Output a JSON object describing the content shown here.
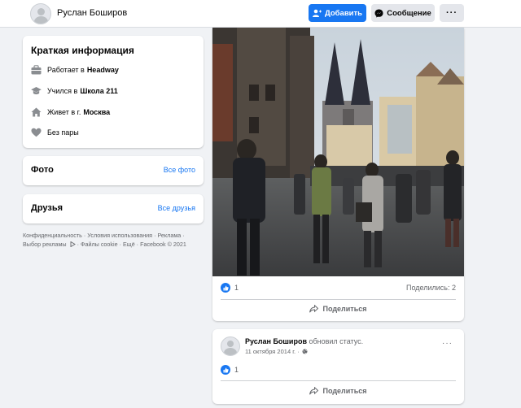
{
  "header": {
    "page_name": "Руслан Боширов",
    "add_label": "Добавить",
    "message_label": "Сообщение",
    "more_label": "···"
  },
  "intro": {
    "title": "Краткая информация",
    "work_prefix": "Работает в",
    "work_value": "Headway",
    "study_prefix": "Учился в",
    "study_value": "Школа 211",
    "city_prefix": "Живет в г.",
    "city_value": "Москва",
    "relationship": "Без пары"
  },
  "photos": {
    "title": "Фото",
    "link": "Все фото"
  },
  "friends": {
    "title": "Друзья",
    "link": "Все друзья"
  },
  "footer": {
    "line1": "Конфиденциальность · Условия использования · Реклама ·",
    "line2_a": "Выбор рекламы",
    "line2_b": " · Файлы cookie · Ещё · Facebook © 2021"
  },
  "post1": {
    "likes": "1",
    "shares": "Поделились: 2",
    "share_label": "Поделиться"
  },
  "post2": {
    "author": "Руслан Боширов",
    "action": " обновил статус.",
    "date": "11 октября 2014 г. ·",
    "more_label": "···",
    "likes": "1",
    "share_label": "Поделиться"
  },
  "colors": {
    "accent": "#1877f2",
    "background": "#f0f2f5",
    "secondary_text": "#65676b"
  }
}
